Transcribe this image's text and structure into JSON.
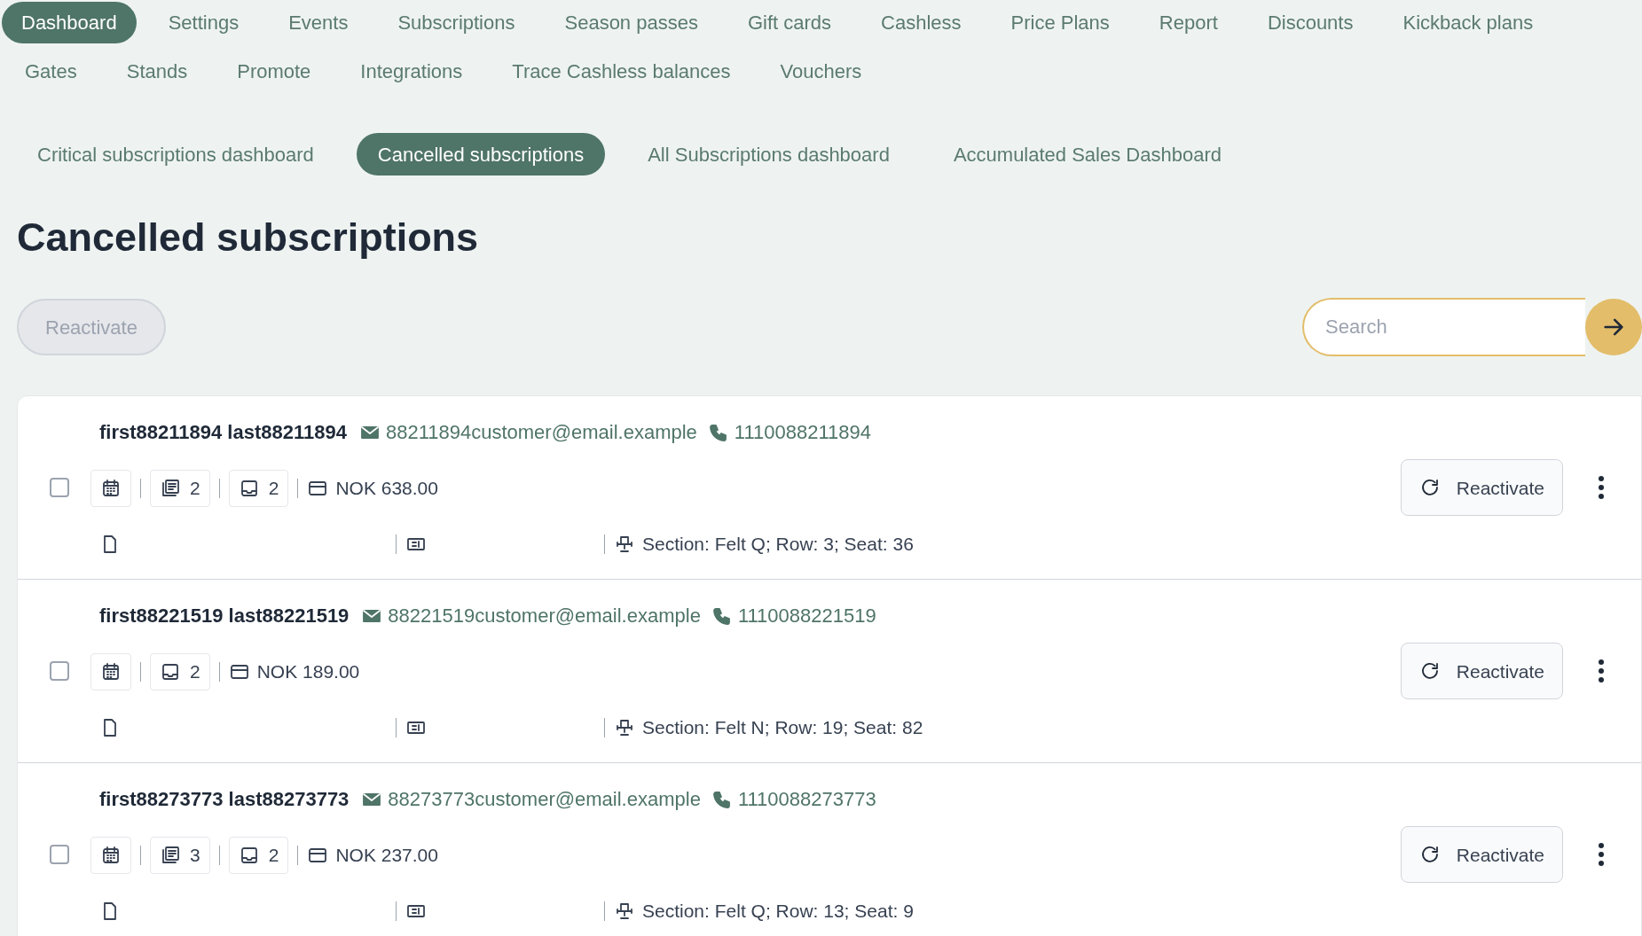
{
  "main_nav": [
    {
      "label": "Dashboard",
      "selected": true
    },
    {
      "label": "Settings",
      "selected": false
    },
    {
      "label": "Events",
      "selected": false
    },
    {
      "label": "Subscriptions",
      "selected": false
    },
    {
      "label": "Season passes",
      "selected": false
    },
    {
      "label": "Gift cards",
      "selected": false
    },
    {
      "label": "Cashless",
      "selected": false
    },
    {
      "label": "Price Plans",
      "selected": false
    },
    {
      "label": "Report",
      "selected": false
    },
    {
      "label": "Discounts",
      "selected": false
    },
    {
      "label": "Kickback plans",
      "selected": false
    },
    {
      "label": "Gates",
      "selected": false
    },
    {
      "label": "Stands",
      "selected": false
    },
    {
      "label": "Promote",
      "selected": false
    },
    {
      "label": "Integrations",
      "selected": false
    },
    {
      "label": "Trace Cashless balances",
      "selected": false
    },
    {
      "label": "Vouchers",
      "selected": false
    }
  ],
  "sub_nav": [
    {
      "label": "Critical subscriptions dashboard",
      "selected": false
    },
    {
      "label": "Cancelled subscriptions",
      "selected": true
    },
    {
      "label": "All Subscriptions dashboard",
      "selected": false
    },
    {
      "label": "Accumulated Sales Dashboard",
      "selected": false
    }
  ],
  "title": "Cancelled subscriptions",
  "toolbar": {
    "reactivate_button": {
      "label": "Reactivate",
      "disabled": true
    },
    "search": {
      "placeholder": "Search"
    }
  },
  "rows": [
    {
      "name": "first88211894 last88211894",
      "email": "88211894customer@email.example",
      "phone": "1110088211894",
      "checked": false,
      "chips": [
        {
          "kind": "calendar"
        },
        {
          "kind": "pages",
          "count": "2"
        },
        {
          "kind": "inbox",
          "count": "2"
        }
      ],
      "price": "NOK 638.00",
      "seat": "Section: Felt Q; Row: 3; Seat: 36",
      "action": "Reactivate"
    },
    {
      "name": "first88221519 last88221519",
      "email": "88221519customer@email.example",
      "phone": "1110088221519",
      "checked": false,
      "chips": [
        {
          "kind": "calendar"
        },
        {
          "kind": "inbox",
          "count": "2"
        }
      ],
      "price": "NOK 189.00",
      "seat": "Section: Felt N; Row: 19; Seat: 82",
      "action": "Reactivate"
    },
    {
      "name": "first88273773 last88273773",
      "email": "88273773customer@email.example",
      "phone": "1110088273773",
      "checked": false,
      "chips": [
        {
          "kind": "calendar"
        },
        {
          "kind": "pages",
          "count": "3"
        },
        {
          "kind": "inbox",
          "count": "2"
        }
      ],
      "price": "NOK 237.00",
      "seat": "Section: Felt Q; Row: 13; Seat: 9",
      "action": "Reactivate"
    }
  ]
}
